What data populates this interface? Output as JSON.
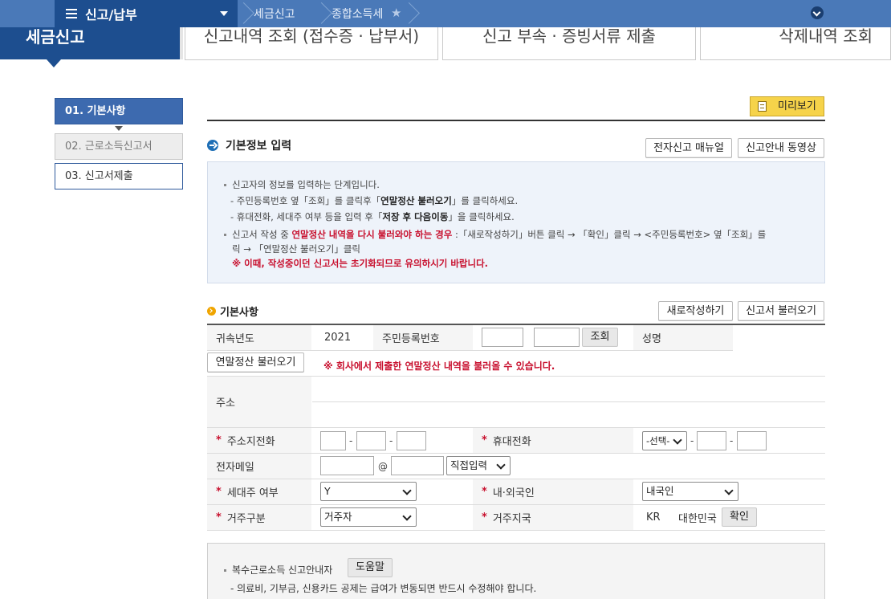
{
  "topnav": {
    "menu_label": "신고/납부",
    "breadcrumb": [
      "세금신고",
      "종합소득세"
    ]
  },
  "header": {
    "brand": "세금신고",
    "tabs": [
      "신고내역 조회 (접수증 · 납부서)",
      "신고 부속 · 증빙서류 제출",
      "삭제내역 조회"
    ]
  },
  "steps": [
    "01. 기본사항",
    "02. 근로소득신고서",
    "03. 신고서제출"
  ],
  "preview_label": "미리보기",
  "section": {
    "title": "기본정보 입력",
    "manual_btn": "전자신고 매뉴얼",
    "video_btn": "신고안내 동영상"
  },
  "info": {
    "l1": "신고자의 정보를 입력하는 단계입니다.",
    "l2a": "- 주민등록번호 옆「조회」를 클릭후「",
    "l2b": "연말정산 불러오기",
    "l2c": "」를 클릭하세요.",
    "l3a": "- 휴대전화, 세대주 여부 등을 입력 후「",
    "l3b": "저장 후 다음이동",
    "l3c": "」을 클릭하세요.",
    "l4a": "신고서 작성 중 ",
    "l4b": "연말정산 내역을 다시 불러와야 하는 경우",
    "l4c": " :「새로작성하기」버튼 클릭 → 「확인」클릭 → <주민등록번호> 옆「조회」를",
    "l5": "릭 → 「연말정산 불러오기」클릭",
    "l6": "※ 이때, 작성중이던 신고서는 초기화되므로 유의하시기 바랍니다."
  },
  "basic": {
    "title": "기본사항",
    "new_btn": "새로작성하기",
    "load_btn": "신고서 불러오기"
  },
  "form": {
    "year_label": "귀속년도",
    "year_value": "2021",
    "rrn_label": "주민등록번호",
    "lookup_btn": "조회",
    "name_label": "성명",
    "yearend_btn": "연말정산 불러오기",
    "yearend_note": "※ 회사에서 제출한 연말정산 내역을 불러올 수 있습니다.",
    "address_label": "주소",
    "phone_label": "주소지전화",
    "mobile_label": "휴대전화",
    "mobile_select": "-선택-",
    "email_label": "전자메일",
    "email_at": "@",
    "email_select": "직접입력",
    "householder_label": "세대주 여부",
    "householder_value": "Y",
    "nationality_label": "내·외국인",
    "nationality_value": "내국인",
    "residence_label": "거주구분",
    "residence_value": "거주자",
    "country_label": "거주지국",
    "country_code": "KR",
    "country_name": "대한민국",
    "confirm_btn": "확인"
  },
  "bottom": {
    "l1": "복수근로소득 신고안내자",
    "help_btn": "도움말",
    "l2": "- 의료비, 기부금, 신용카드 공제는 급여가 변동되면 반드시 수정해야 합니다."
  }
}
